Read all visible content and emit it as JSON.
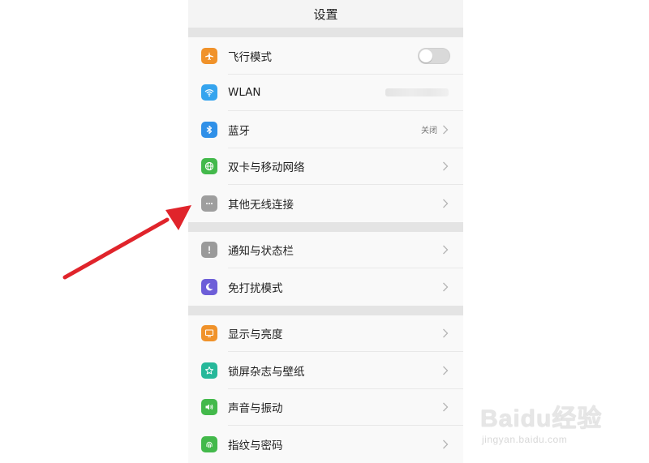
{
  "header": {
    "title": "设置"
  },
  "groups": [
    {
      "items": [
        {
          "label": "飞行模式",
          "icon": "airplane-icon",
          "color": "#f0922a",
          "control": "toggle",
          "toggle_on": false
        },
        {
          "label": "WLAN",
          "icon": "wifi-icon",
          "color": "#35a4ee",
          "control": "blurred"
        },
        {
          "label": "蓝牙",
          "icon": "bluetooth-icon",
          "color": "#2f90e8",
          "value": "关闭",
          "control": "chevron"
        },
        {
          "label": "双卡与移动网络",
          "icon": "globe-icon",
          "color": "#43b94b",
          "control": "chevron"
        },
        {
          "label": "其他无线连接",
          "icon": "more-dots-icon",
          "color": "#9e9e9e",
          "control": "chevron"
        }
      ]
    },
    {
      "items": [
        {
          "label": "通知与状态栏",
          "icon": "exclamation-icon",
          "color": "#9a9a9a",
          "control": "chevron"
        },
        {
          "label": "免打扰模式",
          "icon": "moon-icon",
          "color": "#6d5ed8",
          "control": "chevron"
        }
      ]
    },
    {
      "items": [
        {
          "label": "显示与亮度",
          "icon": "monitor-icon",
          "color": "#f0922a",
          "control": "chevron"
        },
        {
          "label": "锁屏杂志与壁纸",
          "icon": "flower-icon",
          "color": "#26b89a",
          "control": "chevron"
        },
        {
          "label": "声音与振动",
          "icon": "speaker-icon",
          "color": "#43b94b",
          "control": "chevron"
        },
        {
          "label": "指纹与密码",
          "icon": "fingerprint-icon",
          "color": "#43b94b",
          "control": "chevron"
        }
      ]
    }
  ],
  "annotation": {
    "arrow_color": "#e0242b",
    "points_to": "其他无线连接"
  },
  "watermark": {
    "logo": "Baidu经验",
    "sub": "jingyan.baidu.com"
  }
}
